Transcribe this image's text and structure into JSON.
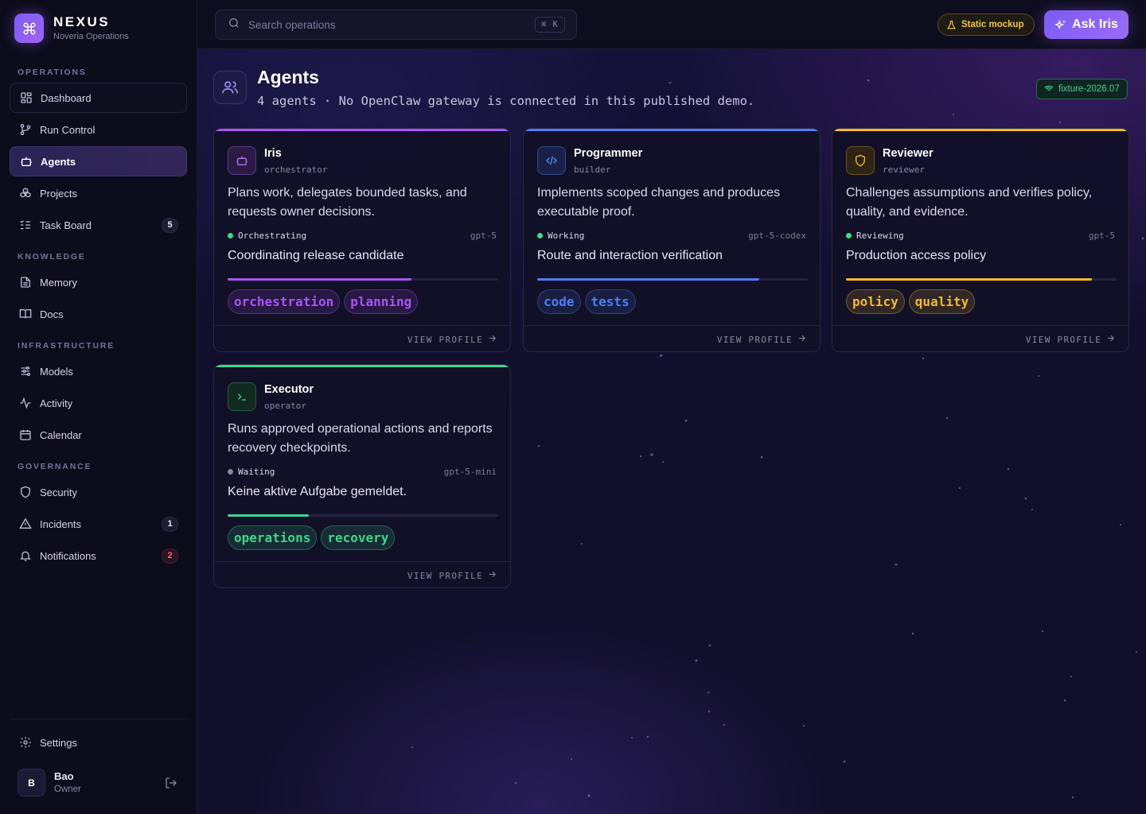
{
  "brand": {
    "name": "NEXUS",
    "subtitle": "Noveria Operations"
  },
  "sidebar": {
    "sections": [
      {
        "label": "OPERATIONS"
      },
      {
        "label": "KNOWLEDGE"
      },
      {
        "label": "INFRASTRUCTURE"
      },
      {
        "label": "GOVERNANCE"
      }
    ],
    "items": [
      {
        "label": "Dashboard",
        "icon": "dashboard-icon"
      },
      {
        "label": "Run Control",
        "icon": "git-branch-icon"
      },
      {
        "label": "Agents",
        "icon": "robot-icon",
        "active": true
      },
      {
        "label": "Projects",
        "icon": "cubes-icon"
      },
      {
        "label": "Task Board",
        "icon": "checklist-icon",
        "badge": "5"
      },
      {
        "label": "Memory",
        "icon": "document-icon"
      },
      {
        "label": "Docs",
        "icon": "book-icon"
      },
      {
        "label": "Models",
        "icon": "sliders-icon"
      },
      {
        "label": "Activity",
        "icon": "pulse-icon"
      },
      {
        "label": "Calendar",
        "icon": "calendar-icon"
      },
      {
        "label": "Security",
        "icon": "shield-icon"
      },
      {
        "label": "Incidents",
        "icon": "warning-icon",
        "badge": "1"
      },
      {
        "label": "Notifications",
        "icon": "bell-icon",
        "badge": "2"
      }
    ],
    "settings": "Settings",
    "user": {
      "initial": "B",
      "name": "Bao",
      "role": "Owner"
    }
  },
  "topbar": {
    "search_placeholder": "Search operations",
    "shortcut": "⌘ K",
    "static_label": "Static mockup",
    "ask_label": "Ask Iris"
  },
  "page": {
    "title": "Agents",
    "subtitle": "4 agents · No OpenClaw gateway is connected in this published demo.",
    "fixture": "fixture-2026.07"
  },
  "agents": [
    {
      "name": "Iris",
      "role": "orchestrator",
      "description": "Plans work, delegates bounded tasks, and requests owner decisions.",
      "status": "Orchestrating",
      "model": "gpt-5",
      "task": "Coordinating release candidate",
      "progress": 0.68,
      "tags": [
        "orchestration",
        "planning"
      ],
      "accent": "#a855f7",
      "status_color": "#3ddc84",
      "view_label": "VIEW PROFILE",
      "icon": "robot-icon"
    },
    {
      "name": "Programmer",
      "role": "builder",
      "description": "Implements scoped changes and produces executable proof.",
      "status": "Working",
      "model": "gpt-5-codex",
      "task": "Route and interaction verification",
      "progress": 0.82,
      "tags": [
        "code",
        "tests"
      ],
      "accent": "#4f7cf5",
      "status_color": "#3ddc84",
      "view_label": "VIEW PROFILE",
      "icon": "code-icon"
    },
    {
      "name": "Reviewer",
      "role": "reviewer",
      "description": "Challenges assumptions and verifies policy, quality, and evidence.",
      "status": "Reviewing",
      "model": "gpt-5",
      "task": "Production access policy",
      "progress": 0.91,
      "tags": [
        "policy",
        "quality"
      ],
      "accent": "#f5b92e",
      "status_color": "#3ddc84",
      "view_label": "VIEW PROFILE",
      "icon": "shield-icon"
    },
    {
      "name": "Executor",
      "role": "operator",
      "description": "Runs approved operational actions and reports recovery checkpoints.",
      "status": "Waiting",
      "model": "gpt-5-mini",
      "task": "Keine aktive Aufgabe gemeldet.",
      "progress": 0.3,
      "tags": [
        "operations",
        "recovery"
      ],
      "accent": "#3dd68c",
      "status_color": "#8a86a6",
      "view_label": "VIEW PROFILE",
      "icon": "terminal-icon"
    }
  ]
}
